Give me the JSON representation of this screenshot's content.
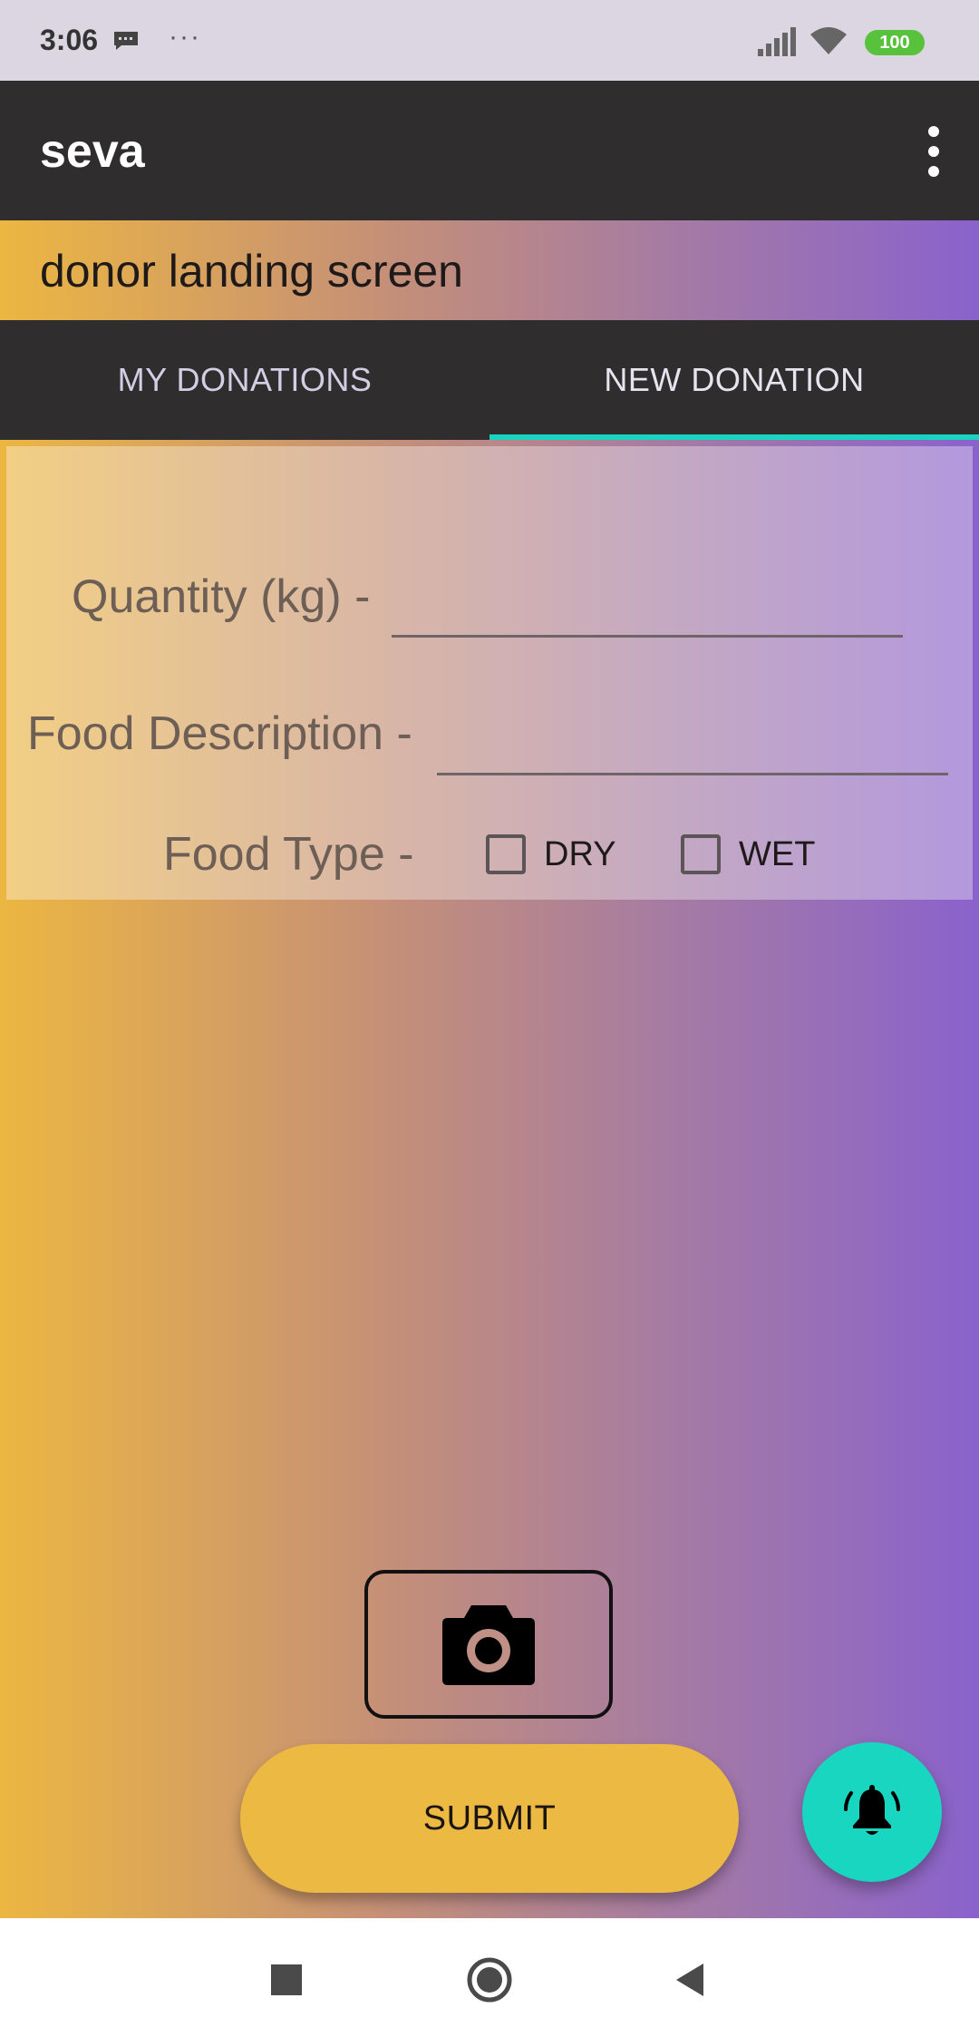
{
  "status_bar": {
    "time": "3:06",
    "overflow_dots": "···",
    "battery": "100"
  },
  "app_bar": {
    "title": "seva"
  },
  "screen_label": "donor landing screen",
  "tabs": [
    {
      "label": "MY DONATIONS",
      "selected": false
    },
    {
      "label": "NEW DONATION",
      "selected": true
    }
  ],
  "form": {
    "quantity_label": "Quantity (kg) -",
    "quantity_value": "",
    "description_label": "Food Description -",
    "description_value": "",
    "food_type_label": "Food Type -",
    "options": [
      {
        "label": "DRY",
        "checked": false
      },
      {
        "label": "WET",
        "checked": false
      }
    ]
  },
  "actions": {
    "submit_label": "SUBMIT"
  },
  "colors": {
    "app_bar": "#2f2d2e",
    "tab_indicator": "#19d4c0",
    "submit": "#ecb942",
    "fab": "#18d6c0",
    "gradient_start": "#ecb642",
    "gradient_end": "#8a62cc"
  },
  "icons": {
    "camera": "camera-icon",
    "fab": "bell-ringing-icon",
    "menu": "more-vert-icon"
  }
}
